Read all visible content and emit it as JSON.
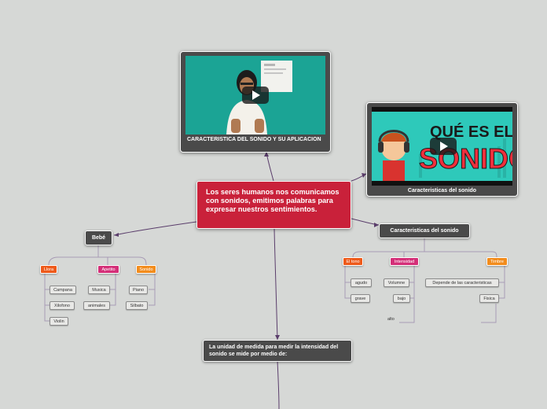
{
  "central_topic": "Los seres humanos nos comunicamos con sonidos, emitimos palabras para expresar nuestros sentimientos.",
  "video1": {
    "caption": "CARACTERISTICA DEL SONIDO Y SU APLICACION",
    "thumbnail_icon": "presenter-video-thumbnail",
    "play_icon": "play-icon"
  },
  "video2": {
    "caption": "Caracteristicas del sonido",
    "thumbnail_line1": "QUÉ ES EL",
    "thumbnail_line2": "SONIDO",
    "play_icon": "play-icon"
  },
  "bebe": {
    "label": "Bebé",
    "branches": [
      {
        "label": "Llora",
        "color": "#ee5a1a",
        "children": [
          "Campana",
          "Xilofono",
          "Violin"
        ]
      },
      {
        "label": "Apetito",
        "color": "#d42f78",
        "children": [
          "Musica",
          "animales"
        ]
      },
      {
        "label": "Sonido",
        "color": "#f28c1c",
        "children": [
          "Piano",
          "Silbato"
        ]
      }
    ]
  },
  "caracteristicas": {
    "label": "Caracteristicas del sonido",
    "branches": [
      {
        "label": "El tono",
        "color": "#ee5a1a",
        "children": [
          "agudo",
          "grave"
        ]
      },
      {
        "label": "Intensidad",
        "color": "#d42f78",
        "children": [
          "Volumne",
          "bajo",
          "alto"
        ]
      },
      {
        "label": "Timbre",
        "color": "#f28c1c",
        "children": [
          "Depende de las caracteristicas",
          "Fisica"
        ]
      }
    ]
  },
  "unidad": {
    "label": "La unidad de medida para medir la intensidad del sonido se mide por medio de:"
  },
  "colors": {
    "background": "#d6d8d6",
    "central": "#c9213a",
    "node_dark": "#4a4a4a",
    "connector": "#5a3d6b",
    "sub_connector": "#a89bb5"
  }
}
